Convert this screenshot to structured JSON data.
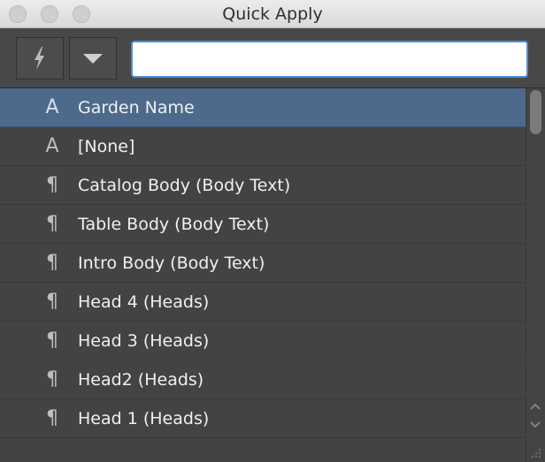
{
  "window": {
    "title": "Quick Apply"
  },
  "toolbar": {
    "bolt_icon": "lightning-bolt-icon",
    "menu_icon": "triangle-down-icon",
    "search": {
      "value": "",
      "placeholder": ""
    }
  },
  "list": {
    "items": [
      {
        "icon": "A",
        "icon_name": "character-style-icon",
        "label": "Garden Name",
        "selected": true
      },
      {
        "icon": "A",
        "icon_name": "character-style-icon",
        "label": "[None]",
        "selected": false
      },
      {
        "icon": "¶",
        "icon_name": "paragraph-style-icon",
        "label": "Catalog Body (Body Text)",
        "selected": false
      },
      {
        "icon": "¶",
        "icon_name": "paragraph-style-icon",
        "label": "Table Body (Body Text)",
        "selected": false
      },
      {
        "icon": "¶",
        "icon_name": "paragraph-style-icon",
        "label": "Intro Body (Body Text)",
        "selected": false
      },
      {
        "icon": "¶",
        "icon_name": "paragraph-style-icon",
        "label": "Head 4 (Heads)",
        "selected": false
      },
      {
        "icon": "¶",
        "icon_name": "paragraph-style-icon",
        "label": "Head 3 (Heads)",
        "selected": false
      },
      {
        "icon": "¶",
        "icon_name": "paragraph-style-icon",
        "label": "Head2 (Heads)",
        "selected": false
      },
      {
        "icon": "¶",
        "icon_name": "paragraph-style-icon",
        "label": "Head 1 (Heads)",
        "selected": false
      }
    ]
  },
  "colors": {
    "selection": "#4d6a8c",
    "background": "#434343",
    "search_focus": "#4b8fd6"
  }
}
